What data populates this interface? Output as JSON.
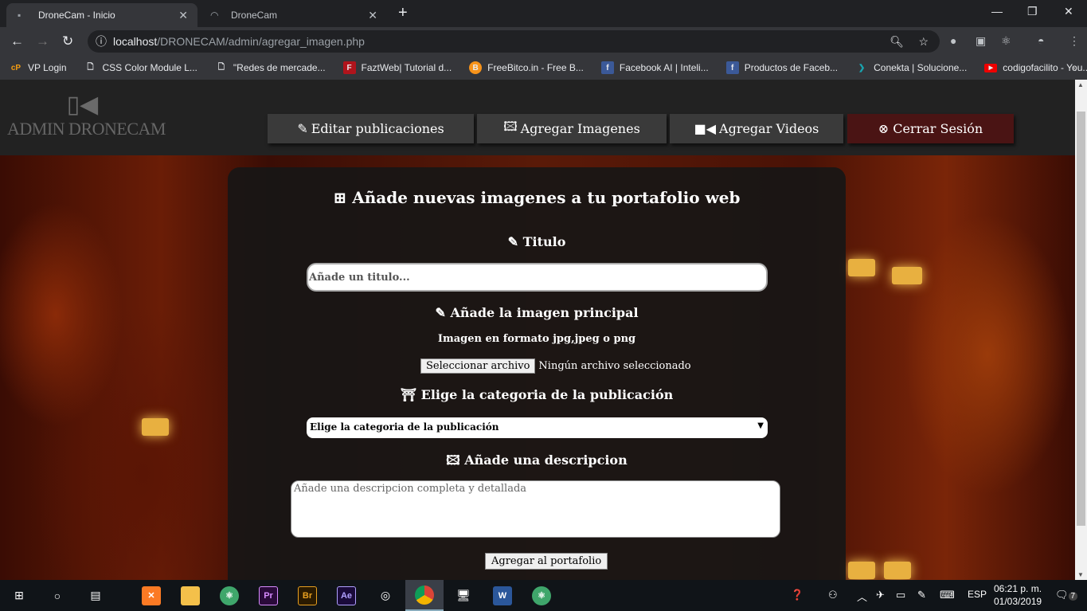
{
  "browser": {
    "tabs": [
      {
        "label": "DroneCam - Inicio",
        "active": true
      },
      {
        "label": "DroneCam",
        "active": false
      }
    ],
    "url_host": "localhost",
    "url_path": "/DRONECAM/admin/agregar_imagen.php",
    "bookmarks": [
      {
        "label": "VP Login",
        "icon": "cp"
      },
      {
        "label": "CSS Color Module L...",
        "icon": "page"
      },
      {
        "label": "\"Redes de mercade...",
        "icon": "page"
      },
      {
        "label": "FaztWeb| Tutorial d...",
        "icon": "F"
      },
      {
        "label": "FreeBitco.in - Free B...",
        "icon": "B"
      },
      {
        "label": "Facebook AI | Inteli...",
        "icon": "f"
      },
      {
        "label": "Productos de Faceb...",
        "icon": "f"
      },
      {
        "label": "Conekta | Solucione...",
        "icon": "conekta"
      },
      {
        "label": "codigofacilito - You...",
        "icon": "youtube"
      }
    ]
  },
  "header": {
    "logo": "ADMIN DRONECAM",
    "nav": [
      "Editar publicaciones",
      "Agregar Imagenes",
      "Agregar Videos",
      "Cerrar Sesión"
    ]
  },
  "form": {
    "title": "Añade nuevas imagenes a tu portafolio web",
    "titulo_label": "Titulo",
    "titulo_placeholder": "Añade un titulo...",
    "imagen_label": "Añade la imagen principal",
    "imagen_hint": "Imagen en formato jpg,jpeg o png",
    "file_button": "Seleccionar archivo",
    "file_status": "Ningún archivo seleccionado",
    "categoria_label": "Elige la categoria de la publicación",
    "categoria_selected": "Elige la categoria de la publicación",
    "descripcion_label": "Añade una descripcion",
    "descripcion_placeholder": "Añade una descripcion completa y detallada",
    "submit": "Agregar al portafolio"
  },
  "taskbar": {
    "lang": "ESP",
    "time": "06:21 p. m.",
    "date": "01/03/2019",
    "notifications": "7"
  },
  "colors": {
    "logout": "#4a1414",
    "nav": "#3a3a3a",
    "header": "#222222"
  }
}
